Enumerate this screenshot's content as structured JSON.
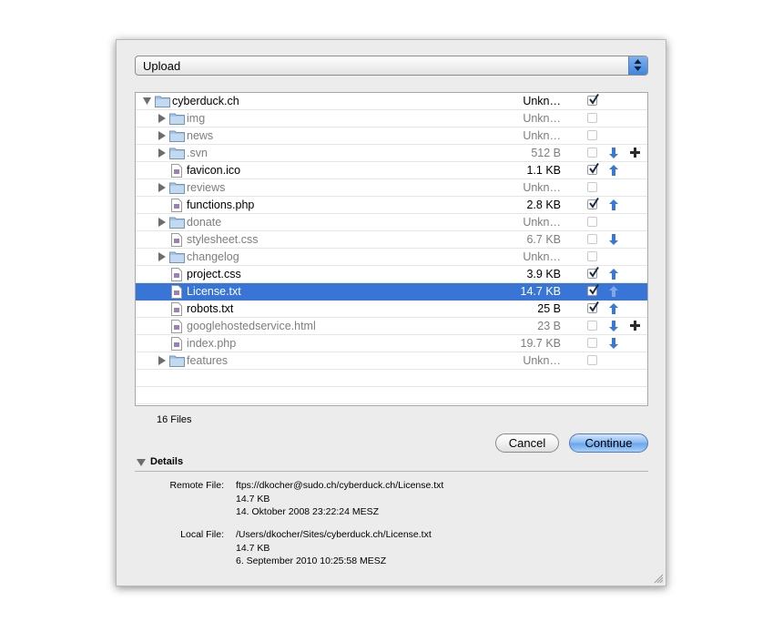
{
  "popup": {
    "selected": "Upload"
  },
  "files": [
    {
      "name": "cyberduck.ch",
      "size": "Unkn…",
      "type": "folder",
      "indent": 0,
      "expanded": true,
      "checked": true,
      "dim": false,
      "arrow": "",
      "plus": false,
      "selected": false
    },
    {
      "name": "img",
      "size": "Unkn…",
      "type": "folder",
      "indent": 1,
      "expanded": false,
      "checked": false,
      "dim": true,
      "arrow": "",
      "plus": false,
      "selected": false
    },
    {
      "name": "news",
      "size": "Unkn…",
      "type": "folder",
      "indent": 1,
      "expanded": false,
      "checked": false,
      "dim": true,
      "arrow": "",
      "plus": false,
      "selected": false
    },
    {
      "name": ".svn",
      "size": "512 B",
      "type": "folder",
      "indent": 1,
      "expanded": false,
      "checked": false,
      "dim": true,
      "arrow": "down",
      "plus": true,
      "selected": false
    },
    {
      "name": "favicon.ico",
      "size": "1.1 KB",
      "type": "file",
      "indent": 1,
      "expanded": false,
      "checked": true,
      "dim": false,
      "arrow": "up",
      "plus": false,
      "selected": false
    },
    {
      "name": "reviews",
      "size": "Unkn…",
      "type": "folder",
      "indent": 1,
      "expanded": false,
      "checked": false,
      "dim": true,
      "arrow": "",
      "plus": false,
      "selected": false
    },
    {
      "name": "functions.php",
      "size": "2.8 KB",
      "type": "file",
      "indent": 1,
      "expanded": false,
      "checked": true,
      "dim": false,
      "arrow": "up",
      "plus": false,
      "selected": false
    },
    {
      "name": "donate",
      "size": "Unkn…",
      "type": "folder",
      "indent": 1,
      "expanded": false,
      "checked": false,
      "dim": true,
      "arrow": "",
      "plus": false,
      "selected": false
    },
    {
      "name": "stylesheet.css",
      "size": "6.7 KB",
      "type": "file",
      "indent": 1,
      "expanded": false,
      "checked": false,
      "dim": true,
      "arrow": "down",
      "plus": false,
      "selected": false
    },
    {
      "name": "changelog",
      "size": "Unkn…",
      "type": "folder",
      "indent": 1,
      "expanded": false,
      "checked": false,
      "dim": true,
      "arrow": "",
      "plus": false,
      "selected": false
    },
    {
      "name": "project.css",
      "size": "3.9 KB",
      "type": "file",
      "indent": 1,
      "expanded": false,
      "checked": true,
      "dim": false,
      "arrow": "up",
      "plus": false,
      "selected": false
    },
    {
      "name": "License.txt",
      "size": "14.7 KB",
      "type": "file",
      "indent": 1,
      "expanded": false,
      "checked": true,
      "dim": false,
      "arrow": "up",
      "plus": false,
      "selected": true
    },
    {
      "name": "robots.txt",
      "size": "25 B",
      "type": "file",
      "indent": 1,
      "expanded": false,
      "checked": true,
      "dim": false,
      "arrow": "up",
      "plus": false,
      "selected": false
    },
    {
      "name": "googlehostedservice.html",
      "size": "23 B",
      "type": "file",
      "indent": 1,
      "expanded": false,
      "checked": false,
      "dim": true,
      "arrow": "down",
      "plus": true,
      "selected": false
    },
    {
      "name": "index.php",
      "size": "19.7 KB",
      "type": "file",
      "indent": 1,
      "expanded": false,
      "checked": false,
      "dim": true,
      "arrow": "down",
      "plus": false,
      "selected": false
    },
    {
      "name": "features",
      "size": "Unkn…",
      "type": "folder",
      "indent": 1,
      "expanded": false,
      "checked": false,
      "dim": true,
      "arrow": "",
      "plus": false,
      "selected": false
    }
  ],
  "file_count": "16 Files",
  "buttons": {
    "cancel": "Cancel",
    "continue": "Continue"
  },
  "details": {
    "label": "Details",
    "remote_label": "Remote File:",
    "remote_path": "ftps://dkocher@sudo.ch/cyberduck.ch/License.txt",
    "remote_size": "14.7 KB",
    "remote_date": "14. Oktober 2008 23:22:24 MESZ",
    "local_label": "Local File:",
    "local_path": "/Users/dkocher/Sites/cyberduck.ch/License.txt",
    "local_size": "14.7 KB",
    "local_date": "6. September 2010 10:25:58 MESZ"
  },
  "colors": {
    "selection": "#3875d7",
    "arrow": "#3a78d6",
    "dim_text": "#7e7e7e"
  }
}
